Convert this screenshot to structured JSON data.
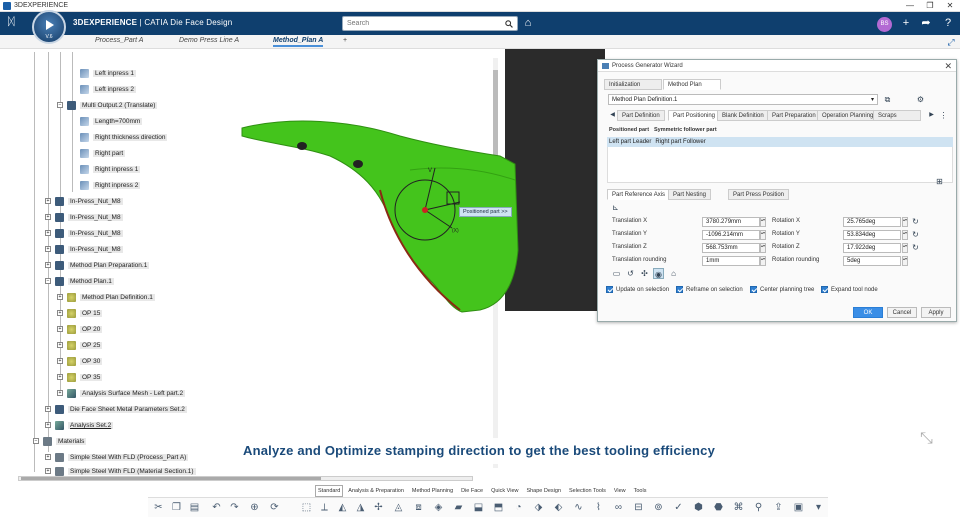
{
  "window": {
    "title": "3DEXPERIENCE",
    "controls": [
      "—",
      "❐",
      "✕"
    ]
  },
  "header": {
    "brand_strong": "3DEXPERIENCE",
    "brand_rest": " | CATIA Die Face Design",
    "compass_version": "V.6",
    "search_placeholder": "Search",
    "avatar_initials": "BS"
  },
  "doc_tabs": [
    {
      "label": "Process_Part A"
    },
    {
      "label": "Demo Press Line A"
    },
    {
      "label": "Method_Plan A"
    },
    {
      "label": "+"
    }
  ],
  "tree": {
    "items": [
      {
        "label": "Left inpress 1"
      },
      {
        "label": "Left inpress 2"
      },
      {
        "label": "Multi Output.2 (Translate)"
      },
      {
        "label": "Length=700mm"
      },
      {
        "label": "Right thickness direction"
      },
      {
        "label": "Right part"
      },
      {
        "label": "Right inpress 1"
      },
      {
        "label": "Right inpress 2"
      },
      {
        "label": "In-Press_Nut_M8"
      },
      {
        "label": "In-Press_Nut_M8"
      },
      {
        "label": "In-Press_Nut_M8"
      },
      {
        "label": "In-Press_Nut_M8"
      },
      {
        "label": "Method Plan Preparation.1"
      },
      {
        "label": "Method Plan.1"
      },
      {
        "label": "Method Plan Definition.1"
      },
      {
        "label": "OP 15"
      },
      {
        "label": "OP 20"
      },
      {
        "label": "OP 25"
      },
      {
        "label": "OP 30"
      },
      {
        "label": "OP 35"
      },
      {
        "label": "Analysis Surface Mesh - Left part.2"
      },
      {
        "label": "Die Face Sheet Metal Parameters Set.2"
      },
      {
        "label": "Analysis Set.2"
      },
      {
        "label": "Materials"
      },
      {
        "label": "Simple Steel With FLD (Process_Part A)"
      },
      {
        "label": "Simple Steel With FLD (Material Section.1)"
      }
    ]
  },
  "viewport": {
    "robot_label": "Positioned part >>"
  },
  "wizard": {
    "title": "Process Generator Wizard",
    "tabs": [
      {
        "label": "Initialization"
      },
      {
        "label": "Method Plan"
      }
    ],
    "select_value": "Method Plan Definition.1",
    "subtabs": [
      {
        "label": "Part Definition"
      },
      {
        "label": "Part Positioning"
      },
      {
        "label": "Blank Definition"
      },
      {
        "label": "Part Preparation"
      },
      {
        "label": "Operation Planning"
      },
      {
        "label": "Scraps"
      }
    ],
    "list_headers": [
      "Positioned part",
      "Symmetric follower part"
    ],
    "list_row": [
      "Left part Leader",
      "Right part Follower"
    ],
    "ref_tabs": [
      {
        "label": "Part Reference Axis"
      },
      {
        "label": "Part Nesting"
      },
      {
        "label": "Part Press Position"
      }
    ],
    "fields_left": [
      {
        "label": "Translation X",
        "value": "3780.279mm"
      },
      {
        "label": "Translation Y",
        "value": "-1096.214mm"
      },
      {
        "label": "Translation Z",
        "value": "568.753mm"
      },
      {
        "label": "Translation rounding",
        "value": "1mm"
      }
    ],
    "fields_right": [
      {
        "label": "Rotation X",
        "value": "25.765deg"
      },
      {
        "label": "Rotation Y",
        "value": "53.834deg"
      },
      {
        "label": "Rotation Z",
        "value": "17.922deg"
      },
      {
        "label": "Rotation rounding",
        "value": "5deg"
      }
    ],
    "checkboxes": [
      {
        "label": "Update on selection",
        "checked": true
      },
      {
        "label": "Reframe on selection",
        "checked": true
      },
      {
        "label": "Center planning tree",
        "checked": true
      },
      {
        "label": "Expand tool node",
        "checked": true
      }
    ],
    "buttons": {
      "ok": "OK",
      "cancel": "Cancel",
      "apply": "Apply"
    }
  },
  "caption": "Analyze and Optimize stamping direction to get the best tooling efficiency",
  "bottom_tabs": [
    {
      "label": "Standard"
    },
    {
      "label": "Analysis & Preparation"
    },
    {
      "label": "Method Planning"
    },
    {
      "label": "Die Face"
    },
    {
      "label": "Quick View"
    },
    {
      "label": "Shape Design"
    },
    {
      "label": "Selection Tools"
    },
    {
      "label": "View"
    },
    {
      "label": "Tools"
    }
  ]
}
